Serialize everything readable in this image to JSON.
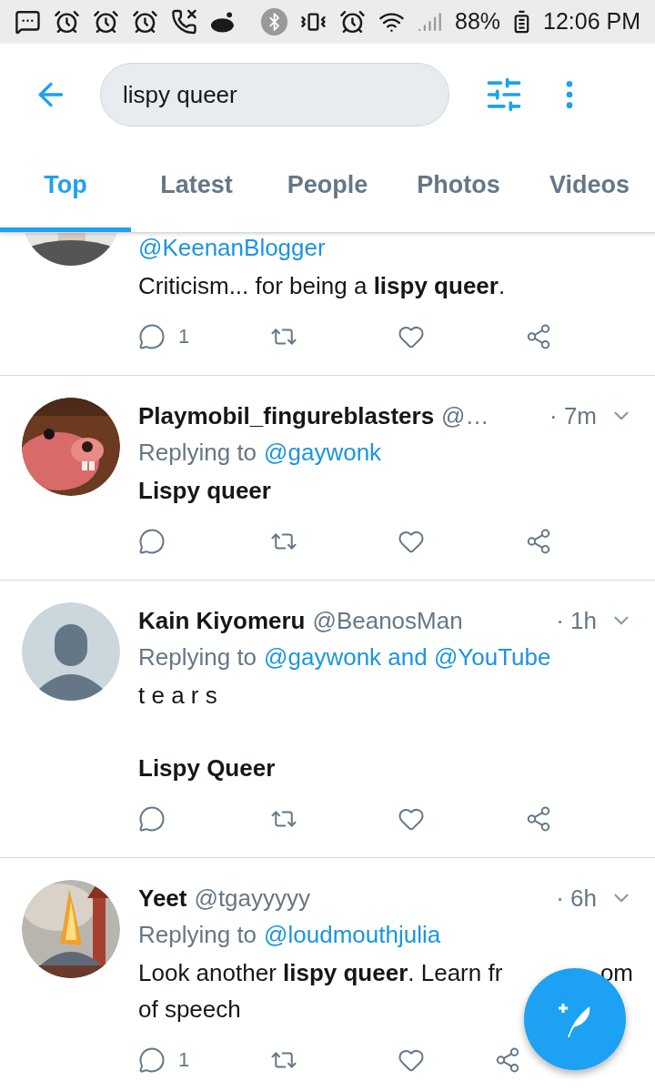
{
  "status_bar": {
    "battery": "88%",
    "time": "12:06 PM"
  },
  "search": {
    "value": "lispy queer"
  },
  "tabs": [
    {
      "label": "Top",
      "selected": true
    },
    {
      "label": "Latest",
      "selected": false
    },
    {
      "label": "People",
      "selected": false
    },
    {
      "label": "Photos",
      "selected": false
    },
    {
      "label": "Videos",
      "selected": false
    }
  ],
  "tweets": [
    {
      "avatar": {
        "kind": "cropped"
      },
      "handle": "@KeenanBlogger",
      "paragraphs": [
        [
          [
            "Criticism... for being a **lispy queer**."
          ]
        ]
      ],
      "replies": "1"
    },
    {
      "avatar": {
        "kind": "picture"
      },
      "name": "Playmobil_fingureblasters",
      "handle": "@…",
      "time": "· 7m",
      "reply": {
        "label": "Replying to",
        "to": "@gaywonk"
      },
      "paragraphs": [
        [
          [
            "**Lispy queer**"
          ]
        ]
      ]
    },
    {
      "avatar": {
        "kind": "default"
      },
      "name": "Kain Kiyomeru",
      "handle": "@BeanosMan",
      "time": "· 1h",
      "reply": {
        "label": "Replying to",
        "to": "@gaywonk and @YouTube"
      },
      "paragraphs": [
        [
          [
            "t e a r s"
          ]
        ],
        [
          [
            "**Lispy Queer**"
          ]
        ]
      ]
    },
    {
      "avatar": {
        "kind": "picture"
      },
      "name": "Yeet",
      "handle": "@tgayyyyy",
      "time": "· 6h",
      "reply": {
        "label": "Replying to",
        "to": "@loudmouthjulia"
      },
      "paragraphs": [
        [
          [
            "Look another **lispy queer**. Learn fr",
            "om"
          ],
          [
            "of speech"
          ]
        ]
      ],
      "replies": "1"
    }
  ]
}
